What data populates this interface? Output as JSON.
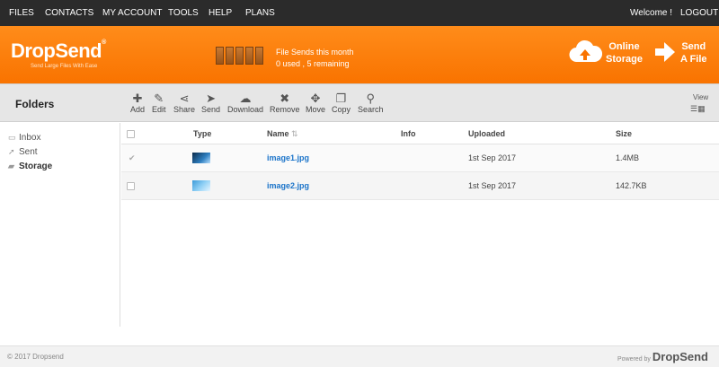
{
  "topnav": {
    "items": [
      "FILES",
      "CONTACTS",
      "MY ACCOUNT",
      "TOOLS",
      "HELP",
      "PLANS"
    ],
    "welcome": "Welcome !",
    "logout": "LOGOUT"
  },
  "banner": {
    "logo": "DropSend",
    "logo_mark": "®",
    "tagline": "Send Large Files With Ease",
    "sends_title": "File Sends this month",
    "sends_status": "0 used , 5 remaining",
    "online_storage": [
      "Online",
      "Storage"
    ],
    "send_file": [
      "Send",
      "A File"
    ]
  },
  "toolbar": {
    "title": "Folders",
    "tools": [
      {
        "label": "Add",
        "icon": "plus-icon",
        "glyph": "✚"
      },
      {
        "label": "Edit",
        "icon": "pencil-icon",
        "glyph": "✎"
      },
      {
        "label": "Share",
        "icon": "share-icon",
        "glyph": "⋖"
      },
      {
        "label": "Send",
        "icon": "paper-plane-icon",
        "glyph": "➤"
      },
      {
        "label": "Download",
        "icon": "cloud-download-icon",
        "glyph": "☁"
      },
      {
        "label": "Remove",
        "icon": "remove-icon",
        "glyph": "✖"
      },
      {
        "label": "Move",
        "icon": "move-icon",
        "glyph": "✥"
      },
      {
        "label": "Copy",
        "icon": "copy-icon",
        "glyph": "❐"
      },
      {
        "label": "Search",
        "icon": "search-icon",
        "glyph": "⚲"
      }
    ],
    "view_label": "View"
  },
  "sidebar": {
    "items": [
      {
        "label": "Inbox",
        "icon": "inbox-icon"
      },
      {
        "label": "Sent",
        "icon": "sent-icon"
      },
      {
        "label": "Storage",
        "icon": "folder-icon",
        "active": true
      }
    ]
  },
  "table": {
    "headers": {
      "type": "Type",
      "name": "Name",
      "info": "Info",
      "uploaded": "Uploaded",
      "size": "Size"
    },
    "rows": [
      {
        "name": "image1.jpg",
        "info": "",
        "uploaded": "1st Sep 2017",
        "size": "1.4MB",
        "checked": true
      },
      {
        "name": "image2.jpg",
        "info": "",
        "uploaded": "1st Sep 2017",
        "size": "142.7KB",
        "checked": false
      }
    ]
  },
  "footer": {
    "copyright": "© 2017 Dropsend",
    "powered_by": "Powered by",
    "brand": "DropSend"
  },
  "colors": {
    "brand_orange": "#f97300",
    "nav_bg": "#2b2b2b",
    "link_blue": "#1a73c9"
  }
}
